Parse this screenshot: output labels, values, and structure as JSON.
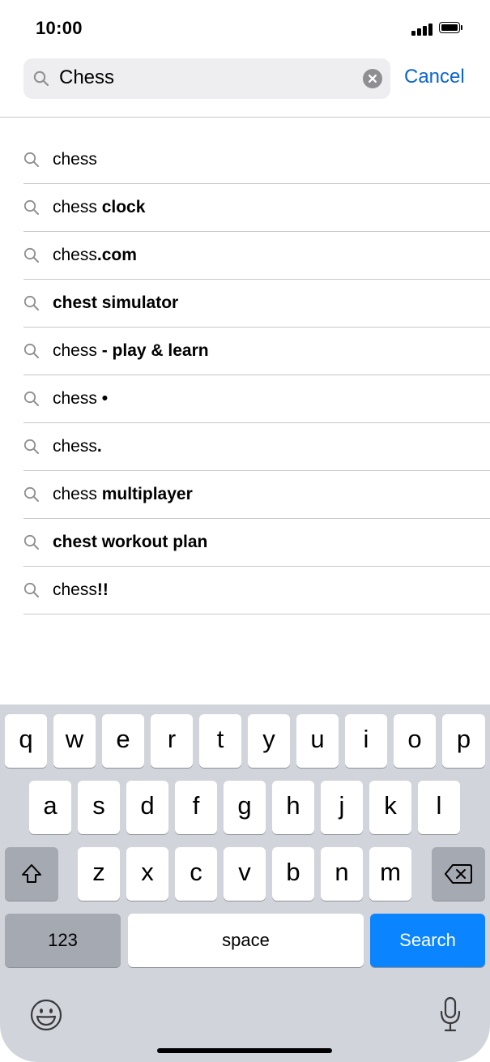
{
  "status_bar": {
    "time": "10:00"
  },
  "search": {
    "query": "Chess",
    "cancel_label": "Cancel"
  },
  "suggestions": [
    {
      "plain": "chess",
      "bold": ""
    },
    {
      "plain": "chess ",
      "bold": "clock"
    },
    {
      "plain": "chess",
      "bold": ".com"
    },
    {
      "plain": "",
      "bold": "chest simulator"
    },
    {
      "plain": "chess ",
      "bold": "- play & learn"
    },
    {
      "plain": "chess ",
      "bold": "•"
    },
    {
      "plain": "chess",
      "bold": "."
    },
    {
      "plain": "chess ",
      "bold": "multiplayer"
    },
    {
      "plain": "",
      "bold": "chest workout plan"
    },
    {
      "plain": "chess",
      "bold": "!!"
    }
  ],
  "keyboard": {
    "row1": [
      "q",
      "w",
      "e",
      "r",
      "t",
      "y",
      "u",
      "i",
      "o",
      "p"
    ],
    "row2": [
      "a",
      "s",
      "d",
      "f",
      "g",
      "h",
      "j",
      "k",
      "l"
    ],
    "row3": [
      "z",
      "x",
      "c",
      "v",
      "b",
      "n",
      "m"
    ],
    "numbers_label": "123",
    "space_label": "space",
    "search_label": "Search"
  },
  "colors": {
    "accent": "#0a64d2",
    "search_key": "#0a84ff",
    "keyboard_bg": "#d1d4db",
    "field_bg": "#eeeef0"
  }
}
